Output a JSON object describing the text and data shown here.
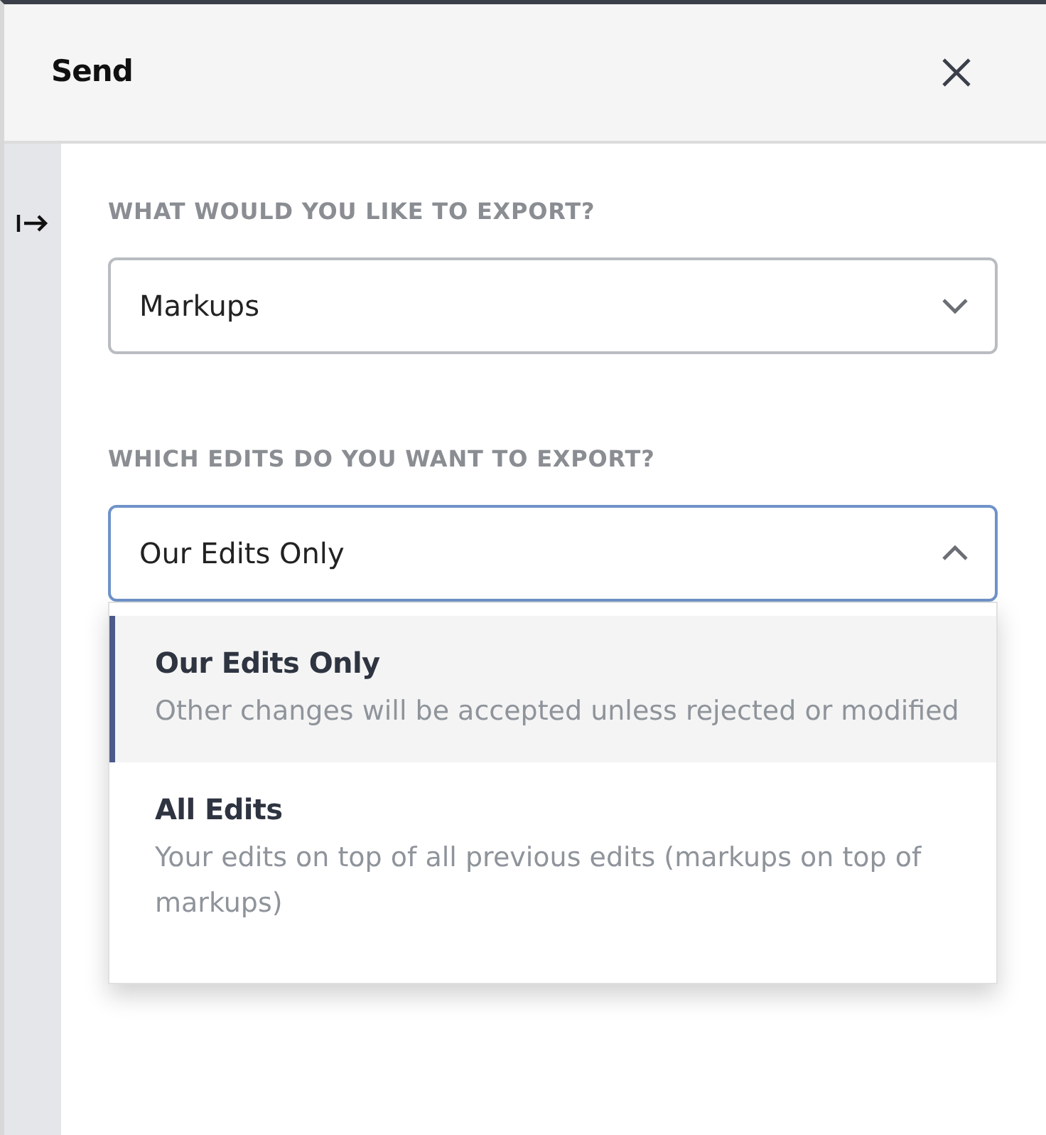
{
  "panel": {
    "title": "Send"
  },
  "fields": [
    {
      "label": "WHAT WOULD YOU LIKE TO EXPORT?",
      "value": "Markups",
      "expanded": false
    },
    {
      "label": "WHICH EDITS DO YOU WANT TO EXPORT?",
      "value": "Our Edits Only",
      "expanded": true,
      "options": [
        {
          "title": "Our Edits Only",
          "description": "Other changes will be accepted unless rejected or modified",
          "selected": true
        },
        {
          "title": "All Edits",
          "description": "Your edits on top of all previous edits (markups on top of markups)",
          "selected": false
        }
      ]
    }
  ]
}
